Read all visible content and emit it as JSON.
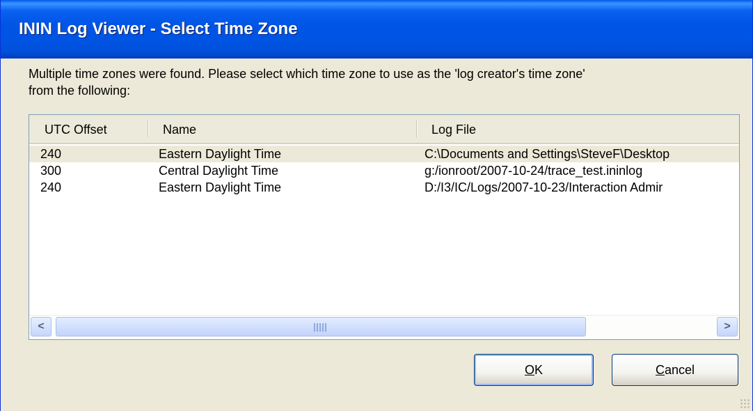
{
  "window": {
    "title": "ININ Log Viewer - Select Time Zone"
  },
  "message": {
    "line1": "Multiple time zones were found.  Please select which time zone to use as the 'log creator's time zone'",
    "line2": "from the following:"
  },
  "table": {
    "columns": [
      "UTC Offset",
      "Name",
      "Log File"
    ],
    "rows": [
      {
        "offset": "240",
        "name": "Eastern Daylight Time",
        "logfile": "C:\\Documents and Settings\\SteveF\\Desktop"
      },
      {
        "offset": "300",
        "name": "Central Daylight Time",
        "logfile": "g:/ionroot/2007-10-24/trace_test.ininlog"
      },
      {
        "offset": "240",
        "name": "Eastern Daylight Time",
        "logfile": "D:/I3/IC/Logs/2007-10-23/Interaction Admir"
      }
    ],
    "selected_row": 0
  },
  "scrollbar": {
    "left_arrow": "<",
    "right_arrow": ">"
  },
  "buttons": {
    "ok": {
      "mnemonic": "O",
      "rest": "K"
    },
    "cancel": {
      "mnemonic": "C",
      "rest": "ancel"
    }
  },
  "colors": {
    "titlebar": "#0054e3",
    "dialog_bg": "#ece9d8",
    "list_border": "#7f9db9"
  }
}
